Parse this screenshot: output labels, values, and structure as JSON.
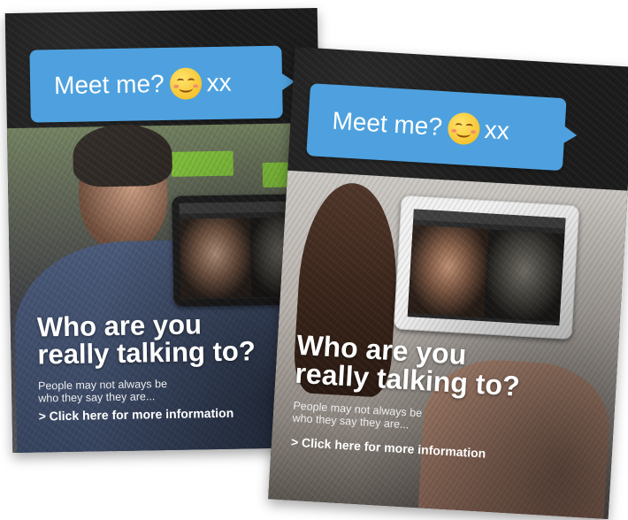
{
  "posters": [
    {
      "bubble": {
        "text": "Meet me?",
        "emoji": "smiling-face-icon",
        "suffix": "xx"
      },
      "headline_line1": "Who are you",
      "headline_line2": "really talking to?",
      "sub_line1": "People may not always be",
      "sub_line2": "who they say they are...",
      "cta": "> Click here for more information"
    },
    {
      "bubble": {
        "text": "Meet me?",
        "emoji": "smiling-face-icon",
        "suffix": "xx"
      },
      "headline_line1": "Who are you",
      "headline_line2": "really talking to?",
      "sub_line1": "People may not always be",
      "sub_line2": "who they say they are...",
      "cta": "> Click here for more information"
    }
  ],
  "colors": {
    "bubble": "#4ea1de",
    "text": "#ffffff",
    "background": "#1c1c1c"
  }
}
